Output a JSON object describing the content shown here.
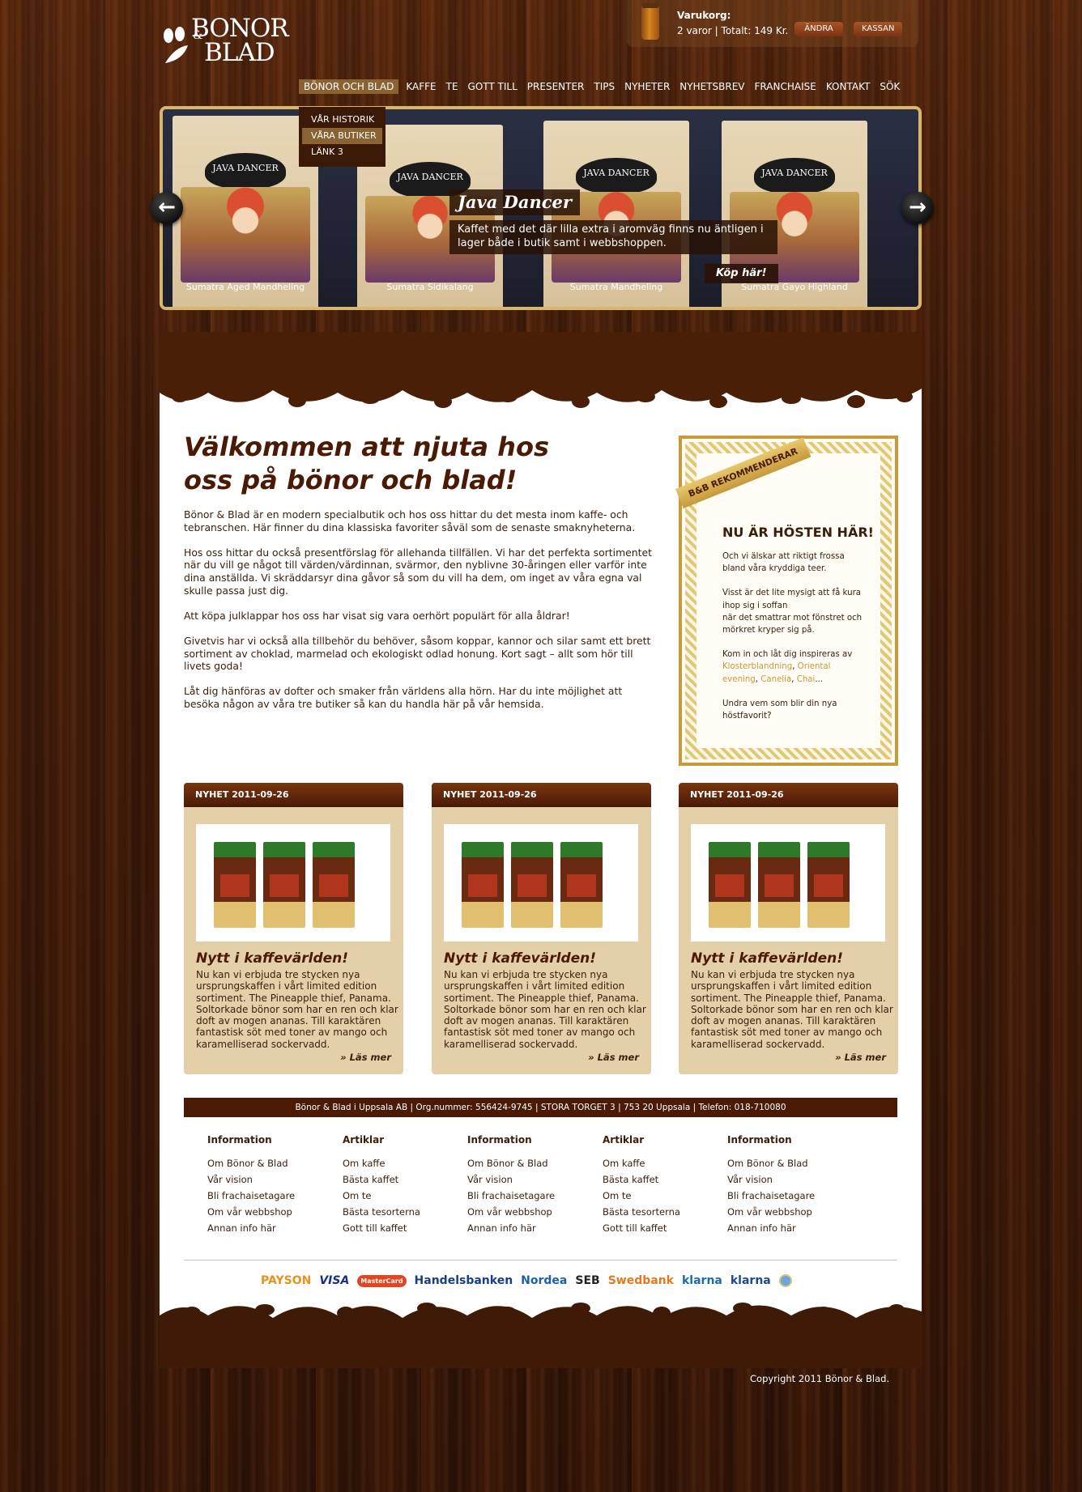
{
  "brand": {
    "logo_text_1": "BONOR",
    "logo_amp": "&",
    "logo_text_2": "BLAD"
  },
  "cart": {
    "title": "Varukorg:",
    "info": "2 varor | Totalt: 149 Kr.",
    "edit_label": "ÄNDRA",
    "checkout_label": "KASSAN"
  },
  "nav": {
    "items": [
      "BÖNOR OCH BLAD",
      "KAFFE",
      "TE",
      "GOTT TILL",
      "PRESENTER",
      "TIPS",
      "NYHETER",
      "NYHETSBREV",
      "FRANCHAISE",
      "KONTAKT",
      "SÖK"
    ],
    "dropdown": [
      "VÅR HISTORIK",
      "VÅRA BUTIKER",
      "LÄNK 3"
    ]
  },
  "slider": {
    "title": "Java Dancer",
    "text": "Kaffet med det där lilla extra i aromväg finns nu äntligen i lager både i butik samt i webbshoppen.",
    "buy_label": "Köp här!",
    "prev_icon": "arrow-left-icon",
    "next_icon": "arrow-right-icon",
    "bags": [
      {
        "label": "JAVA DANCER",
        "name": "Sumatra Aged Mandheling"
      },
      {
        "label": "JAVA DANCER",
        "name": "Sumatra Sidikalang"
      },
      {
        "label": "JAVA DANCER",
        "name": "Sumatra Mandheling"
      },
      {
        "label": "JAVA DANCER",
        "name": "Sumatra Gayo Highland"
      }
    ]
  },
  "welcome": {
    "title_line1": "Välkommen att njuta hos",
    "title_line2": "oss på bönor och blad!",
    "paragraphs": [
      "Bönor & Blad är en modern specialbutik och hos oss hittar du det mesta inom kaffe- och tebranschen. Här finner du dina klassiska favoriter såväl som de senaste smaknyheterna.",
      "Hos oss hittar du också presentförslag för allehanda tillfällen. Vi har det perfekta sortimentet när du vill ge något till värden/värdinnan, svärmor, den nyblivne 30-åringen eller varför inte dina anställda. Vi skräddarsyr dina gåvor så som du vill ha dem, om inget av våra egna val skulle passa just dig.",
      "Att köpa julklappar hos oss har visat sig vara oerhört populärt för alla åldrar!",
      "Givetvis har vi också alla tillbehör du behöver, såsom koppar, kannor och silar samt ett brett sortiment av choklad, marmelad och ekologiskt odlad honung. Kort sagt – allt som hör till livets goda!",
      "Låt dig hänföras av dofter och smaker från världens alla hörn. Har du inte möjlighet att besöka någon av våra tre butiker så kan du handla här på vår hemsida."
    ]
  },
  "recommend": {
    "ribbon": "B&B REKOMMENDERAR",
    "title": "NU ÄR HÖSTEN HÄR!",
    "p1": "Och vi älskar att riktigt frossa bland våra kryddiga teer.",
    "p2a": "Visst är det lite mysigt att få kura ihop sig i soffan",
    "p2b": "när det smattrar mot fönstret och mörkret kryper sig på.",
    "p3": "Kom in och låt dig inspireras av",
    "links": [
      "Klosterblandning",
      "Oriental evening",
      "Canelia",
      "Chai"
    ],
    "p4": "Undra vem som blir din nya höstfavorit?"
  },
  "news": [
    {
      "header": "NYHET 2011-09-26",
      "title": "Nytt i kaffevärlden!",
      "text": "Nu kan vi erbjuda tre stycken nya ursprungskaffen i vårt limited edition sortiment. The Pineapple thief, Panama. Soltorkade bönor som har en ren och klar doft av mogen ananas. Till karaktären fantastisk söt med toner av mango och karamelliserad sockervadd.",
      "more": "» Läs mer"
    },
    {
      "header": "NYHET 2011-09-26",
      "title": "Nytt i kaffevärlden!",
      "text": "Nu kan vi erbjuda tre stycken nya ursprungskaffen i vårt limited edition sortiment. The Pineapple thief, Panama. Soltorkade bönor som har en ren och klar doft av mogen ananas. Till karaktären fantastisk söt med toner av mango och karamelliserad sockervadd.",
      "more": "» Läs mer"
    },
    {
      "header": "NYHET 2011-09-26",
      "title": "Nytt i kaffevärlden!",
      "text": "Nu kan vi erbjuda tre stycken nya ursprungskaffen i vårt limited edition sortiment. The Pineapple thief, Panama. Soltorkade bönor som har en ren och klar doft av mogen ananas. Till karaktären fantastisk söt med toner av mango och karamelliserad sockervadd.",
      "more": "» Läs mer"
    }
  ],
  "footer": {
    "address": "Bönor & Blad i Uppsala AB | Org.nummer: 556424-9745 | STORA TORGET 3 | 753 20 Uppsala | Telefon: 018-710080",
    "columns": [
      {
        "heading": "Information",
        "items": [
          "Om Bönor & Blad",
          "Vår vision",
          "Bli frachaisetagare",
          "Om vår webbshop",
          "Annan info här"
        ]
      },
      {
        "heading": "Artiklar",
        "items": [
          "Om kaffe",
          "Bästa kaffet",
          "Om te",
          "Bästa tesorterna",
          "Gott till kaffet"
        ]
      },
      {
        "heading": "Information",
        "items": [
          "Om Bönor & Blad",
          "Vår vision",
          "Bli frachaisetagare",
          "Om vår webbshop",
          "Annan info här"
        ]
      },
      {
        "heading": "Artiklar",
        "items": [
          "Om kaffe",
          "Bästa kaffet",
          "Om te",
          "Bästa tesorterna",
          "Gott till kaffet"
        ]
      },
      {
        "heading": "Information",
        "items": [
          "Om Bönor & Blad",
          "Vår vision",
          "Bli frachaisetagare",
          "Om vår webbshop",
          "Annan info här"
        ]
      }
    ],
    "payments": [
      "PAYSON",
      "VISA",
      "MasterCard",
      "Handelsbanken",
      "Nordea",
      "SEB",
      "Swedbank",
      "klarna",
      "klarna"
    ],
    "copyright": "Copyright 2011 Bönor & Blad."
  },
  "colors": {
    "brown_dark": "#4a1a05",
    "gold": "#c79a3a",
    "tan": "#e3cfa8",
    "accent_link": "#c79a3a"
  }
}
